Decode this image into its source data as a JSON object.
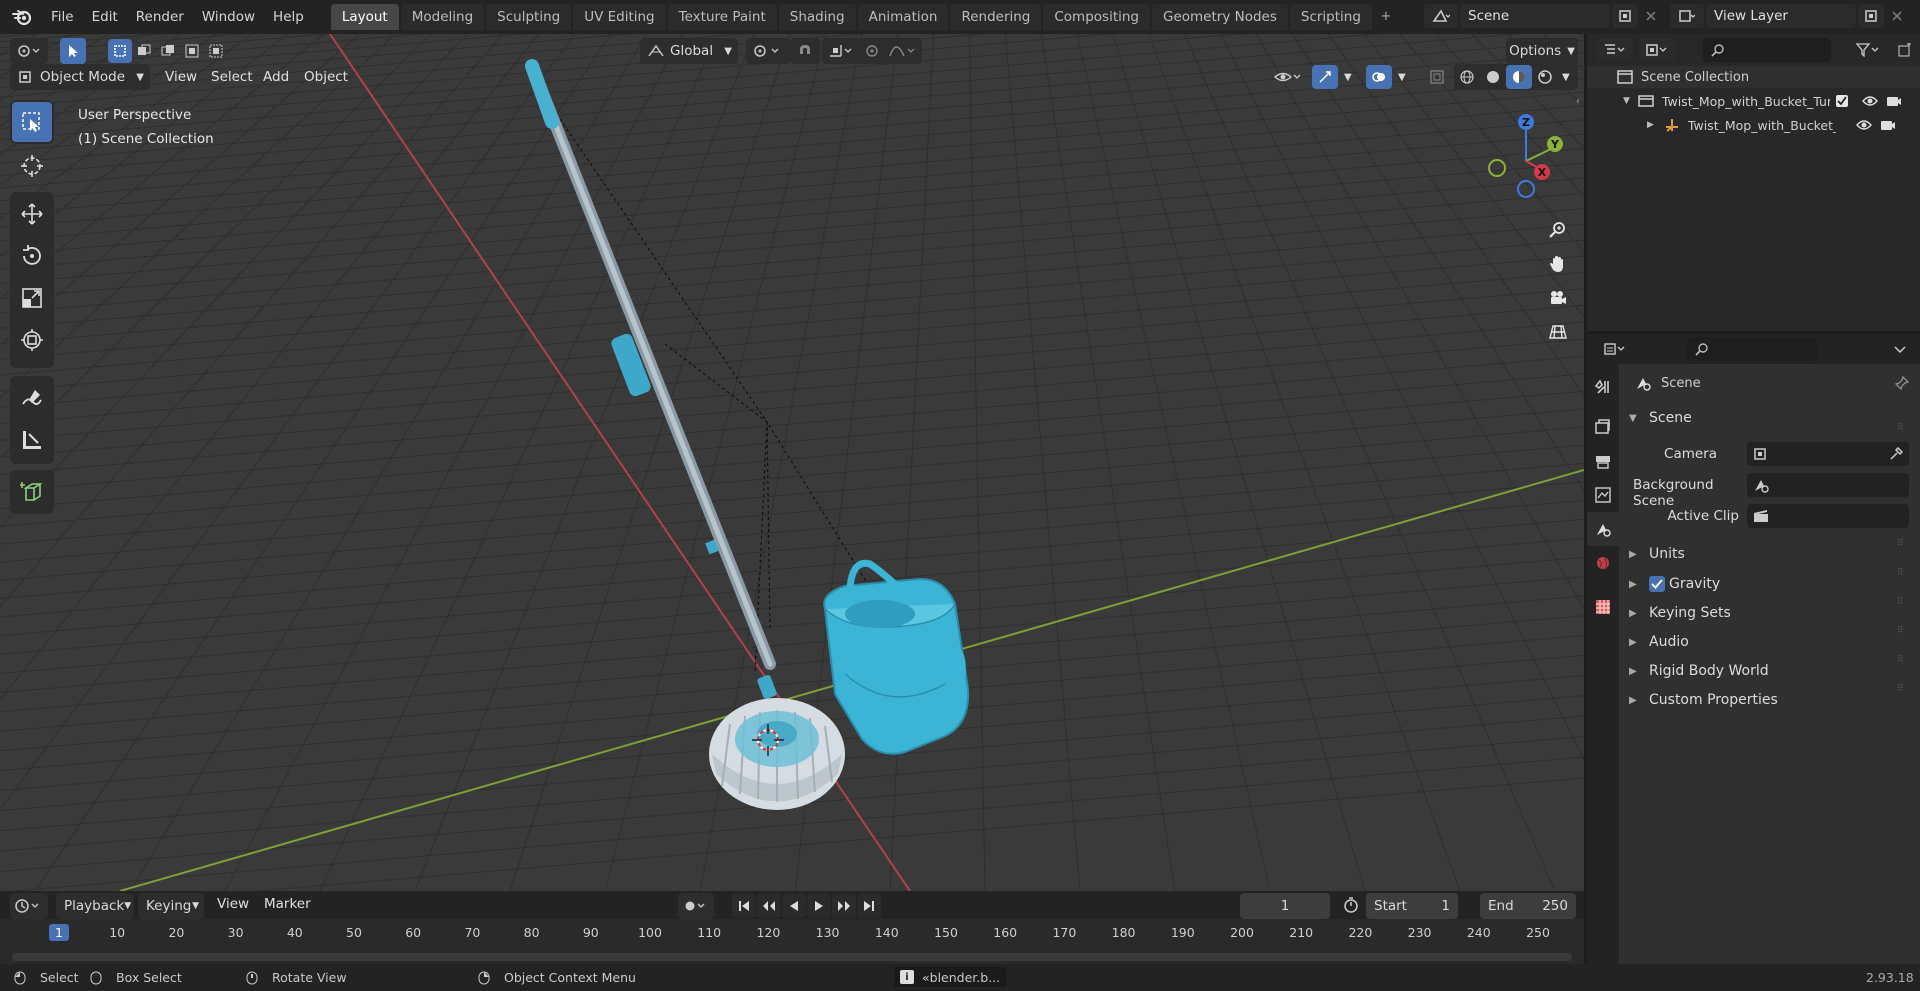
{
  "menu": [
    "File",
    "Edit",
    "Render",
    "Window",
    "Help"
  ],
  "workspaces": [
    {
      "label": "Layout",
      "active": true
    },
    {
      "label": "Modeling"
    },
    {
      "label": "Sculpting"
    },
    {
      "label": "UV Editing"
    },
    {
      "label": "Texture Paint"
    },
    {
      "label": "Shading"
    },
    {
      "label": "Animation"
    },
    {
      "label": "Rendering"
    },
    {
      "label": "Compositing"
    },
    {
      "label": "Geometry Nodes"
    },
    {
      "label": "Scripting"
    }
  ],
  "workspace_add": "+",
  "scene_field": "Scene",
  "view_layer_field": "View Layer",
  "viewport": {
    "mode": "Object Mode",
    "menus": [
      "View",
      "Select",
      "Add",
      "Object"
    ],
    "transform_orientation": "Global",
    "options_label": "Options",
    "overlay_title": "User Perspective",
    "overlay_collection": "(1) Scene Collection",
    "gizmo_axes": [
      "Z",
      "Y",
      "X"
    ]
  },
  "outliner": {
    "root": "Scene Collection",
    "items": [
      {
        "label": "Twist_Mop_with_Bucket_Turq",
        "level": 1
      },
      {
        "label": "Twist_Mop_with_Bucket_",
        "level": 2
      }
    ]
  },
  "properties": {
    "context": "Scene",
    "panel_title": "Scene",
    "camera_label": "Camera",
    "background_scene_label": "Background Scene",
    "active_clip_label": "Active Clip",
    "subpanels": [
      "Units",
      "Gravity",
      "Keying Sets",
      "Audio",
      "Rigid Body World",
      "Custom Properties"
    ],
    "gravity_checked": true
  },
  "timeline": {
    "menus": [
      "Playback",
      "Keying",
      "View",
      "Marker"
    ],
    "current_frame": "1",
    "start_label": "Start",
    "start_value": "1",
    "end_label": "End",
    "end_value": "250",
    "ticks": [
      "1",
      "10",
      "20",
      "30",
      "40",
      "50",
      "60",
      "70",
      "80",
      "90",
      "100",
      "110",
      "120",
      "130",
      "140",
      "150",
      "160",
      "170",
      "180",
      "190",
      "200",
      "210",
      "220",
      "230",
      "240",
      "250"
    ]
  },
  "statusbar": {
    "select": "Select",
    "box_select": "Box Select",
    "rotate_view": "Rotate View",
    "context_menu": "Object Context Menu",
    "notification": "«blender.b...",
    "version": "2.93.18"
  },
  "colors": {
    "accent": "#4772b3",
    "x_axis": "#d33a4a",
    "y_axis": "#8ab235",
    "z_axis": "#3e7be0",
    "mop_turquoise": "#3cb4d6"
  }
}
